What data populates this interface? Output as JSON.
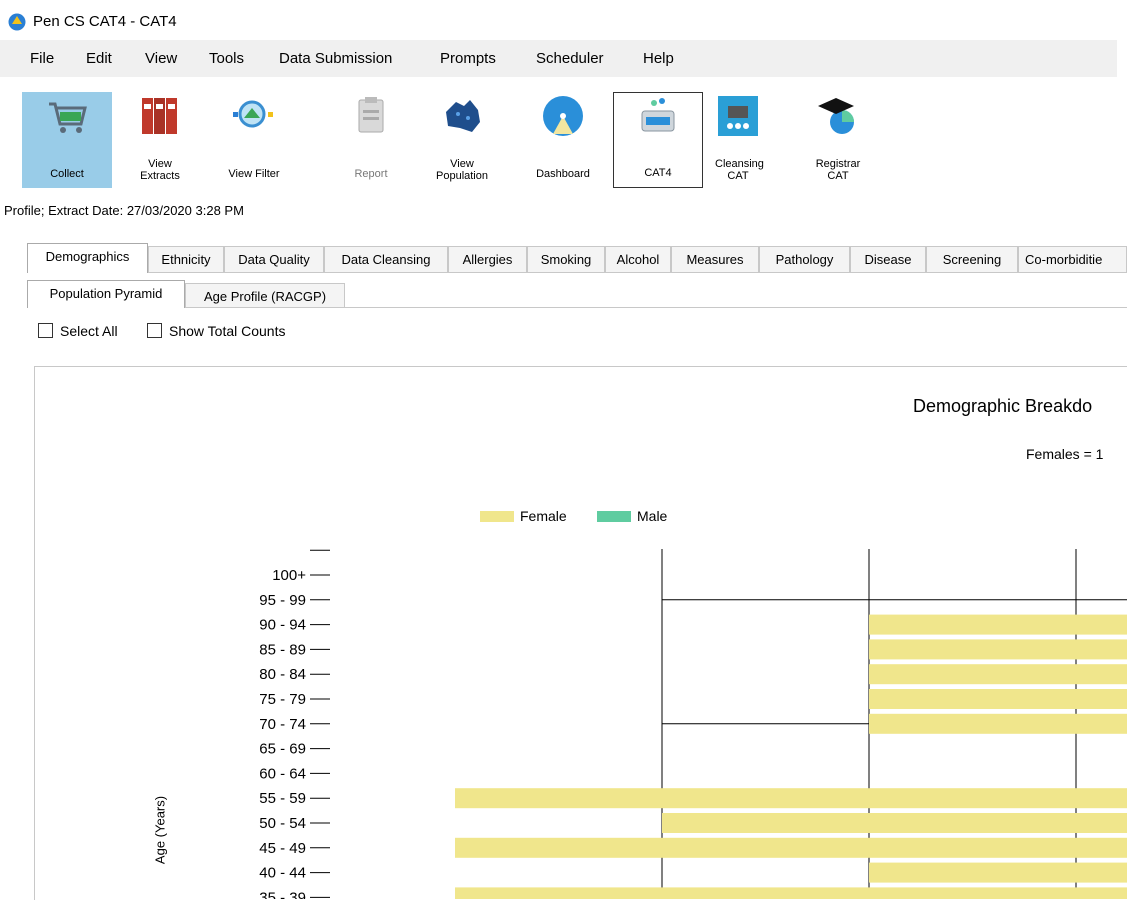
{
  "window": {
    "title": "Pen CS CAT4 - CAT4"
  },
  "menu": [
    "File",
    "Edit",
    "View",
    "Tools",
    "Data Submission",
    "Prompts",
    "Scheduler",
    "Help"
  ],
  "toolbar": [
    {
      "id": "collect",
      "label": "Collect",
      "icon": "shopping-cart-icon"
    },
    {
      "id": "view-extracts",
      "label": "View Extracts",
      "icon": "binders-icon"
    },
    {
      "id": "view-filter",
      "label": "View Filter",
      "icon": "magnifier-filter-icon"
    },
    {
      "id": "report",
      "label": "Report",
      "icon": "clipboard-icon"
    },
    {
      "id": "view-population",
      "label": "View Population",
      "icon": "australia-map-icon"
    },
    {
      "id": "dashboard",
      "label": "Dashboard",
      "icon": "dashboard-gauge-icon"
    },
    {
      "id": "cat4",
      "label": "CAT4",
      "icon": "cat4-box-icon"
    },
    {
      "id": "cleansing-cat",
      "label": "Cleansing CAT",
      "icon": "cleansing-icon"
    },
    {
      "id": "registrar-cat",
      "label": "Registrar CAT",
      "icon": "graduation-cap-icon"
    }
  ],
  "profile_line": "Profile; Extract Date: 27/03/2020 3:28 PM",
  "tabs": [
    "Demographics",
    "Ethnicity",
    "Data Quality",
    "Data Cleansing",
    "Allergies",
    "Smoking",
    "Alcohol",
    "Measures",
    "Pathology",
    "Disease",
    "Screening",
    "Co-morbiditie"
  ],
  "active_tab": "Demographics",
  "subtabs": [
    "Population Pyramid",
    "Age Profile (RACGP)"
  ],
  "active_subtab": "Population Pyramid",
  "options": {
    "select_all": "Select All",
    "show_total_counts": "Show Total Counts"
  },
  "colors": {
    "female": "#f0e68c",
    "male": "#5fcca0",
    "selected_tool": "#99cce8",
    "menu_bg": "#f0f0f0"
  },
  "chart_data": {
    "type": "bar",
    "orientation": "horizontal",
    "title": "Demographic Breakdo",
    "subtitle": "Females = 1",
    "ylabel": "Age (Years)",
    "legend": [
      "Female",
      "Male"
    ],
    "legend_position": "top",
    "categories": [
      "100+",
      "95 - 99",
      "90 - 94",
      "85 - 89",
      "80 - 84",
      "75 - 79",
      "70 - 74",
      "65 - 69",
      "60 - 64",
      "55 - 59",
      "50 - 54",
      "45 - 49",
      "40 - 44",
      "35 - 39"
    ],
    "series": [
      {
        "name": "Female",
        "values": [
          0,
          0,
          1,
          1,
          1,
          1,
          1,
          0,
          0,
          3,
          2,
          3,
          1,
          3
        ]
      }
    ],
    "xlim": [
      -3,
      0.2
    ],
    "grid": true
  }
}
